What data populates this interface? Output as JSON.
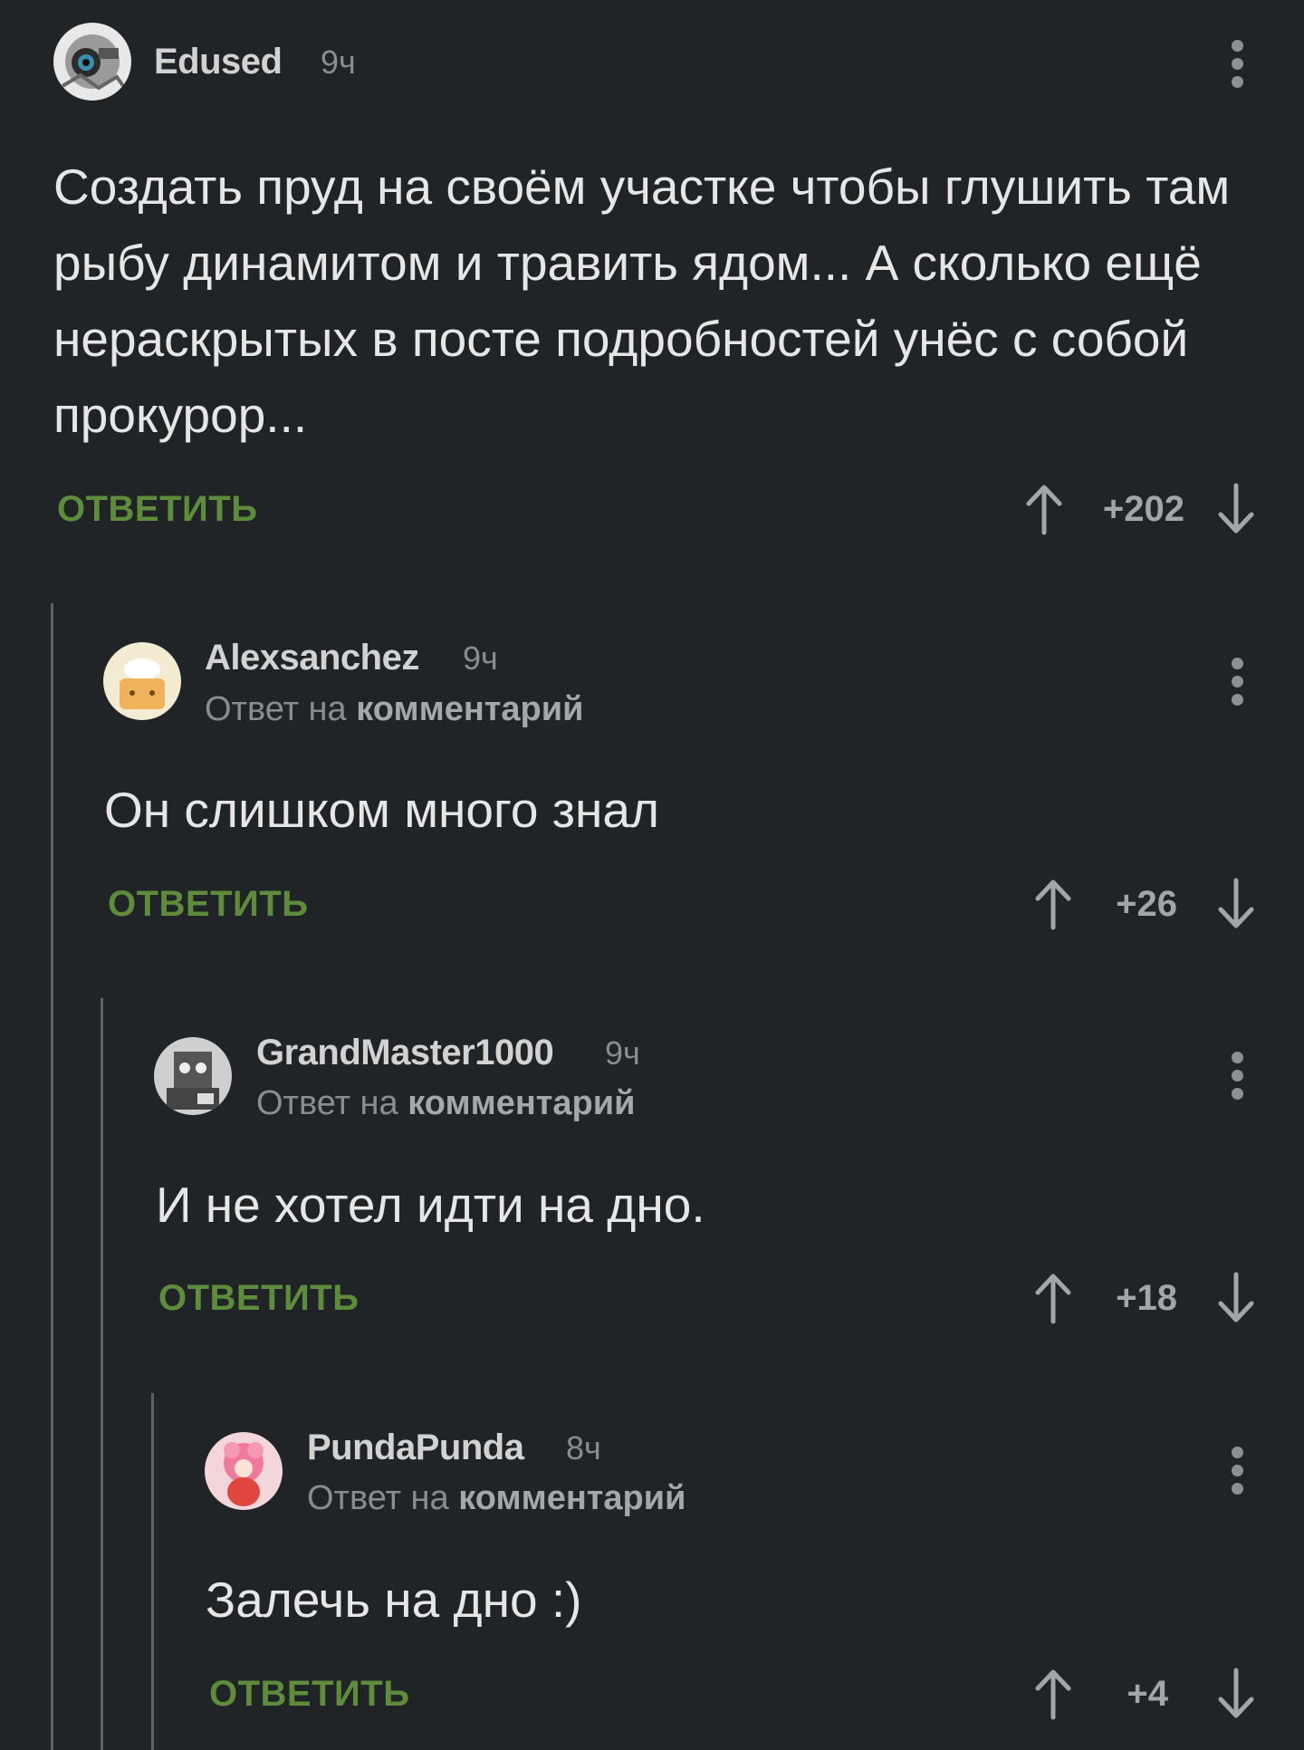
{
  "comments": [
    {
      "author": "Edused",
      "time": "9ч",
      "reply_prefix": "",
      "reply_link": "",
      "text": "Создать пруд на своём участке чтобы глушить там рыбу динамитом и травить ядом... А сколько ещё нераскрытых в посте подробностей унёс с собой прокурор...",
      "reply_label": "ОТВЕТИТЬ",
      "score": "+202"
    },
    {
      "author": "Alexsanchez",
      "time": "9ч",
      "reply_prefix": "Ответ на",
      "reply_link": "комментарий",
      "text": "Он слишком много знал",
      "reply_label": "ОТВЕТИТЬ",
      "score": "+26"
    },
    {
      "author": "GrandMaster1000",
      "time": "9ч",
      "reply_prefix": "Ответ на",
      "reply_link": "комментарий",
      "text": "И не хотел идти на дно.",
      "reply_label": "ОТВЕТИТЬ",
      "score": "+18"
    },
    {
      "author": "PundaPunda",
      "time": "8ч",
      "reply_prefix": "Ответ на",
      "reply_link": "комментарий",
      "text": "Залечь на дно :)",
      "reply_label": "ОТВЕТИТЬ",
      "score": "+4"
    }
  ],
  "icons": {
    "more": "more-vertical-icon",
    "upvote": "arrow-up-icon",
    "downvote": "arrow-down-icon"
  },
  "colors": {
    "background": "#212427",
    "reply_button": "#5d8c3a",
    "text": "#e6e6e6",
    "muted": "#8a8d90"
  }
}
